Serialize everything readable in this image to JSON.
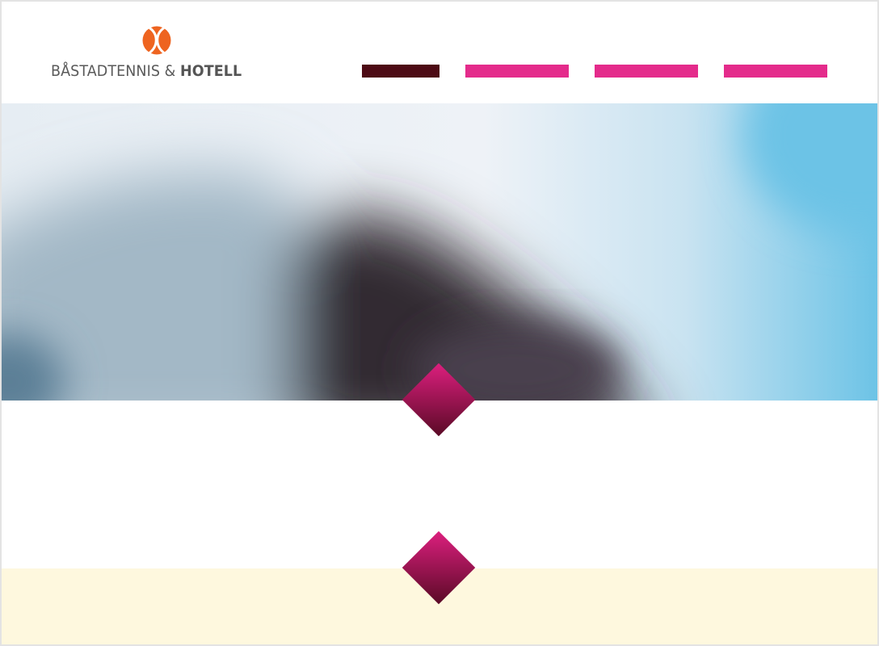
{
  "brand": {
    "name_regular": "BÅSTADTENNIS & ",
    "name_bold": "HOTELL",
    "logo_icon": "tennis-ball-icon",
    "logo_color": "#ee6420",
    "text_color": "#5a5a5a"
  },
  "nav": {
    "items": [
      {
        "state": "active",
        "color": "#4d0a14"
      },
      {
        "state": "inactive",
        "color": "#e42b8b"
      },
      {
        "state": "inactive",
        "color": "#e42b8b"
      },
      {
        "state": "inactive",
        "color": "#e42b8b"
      }
    ]
  },
  "hero": {
    "description": "blurred-photo",
    "colors": {
      "sky_light": "#eef2f7",
      "sky_blue": "#6cc3e6",
      "building_gray": "#a3b8c6",
      "building_dark": "#332c33",
      "edge_blue": "#5c7f96"
    }
  },
  "diamonds": [
    {
      "icon": "diamond-ornament-icon",
      "color_top": "#dc1f7e",
      "color_bottom": "#5a0a26"
    },
    {
      "icon": "diamond-ornament-icon",
      "color_top": "#dc1f7e",
      "color_bottom": "#5a0a26"
    }
  ],
  "footer": {
    "background": "#fef8de"
  }
}
